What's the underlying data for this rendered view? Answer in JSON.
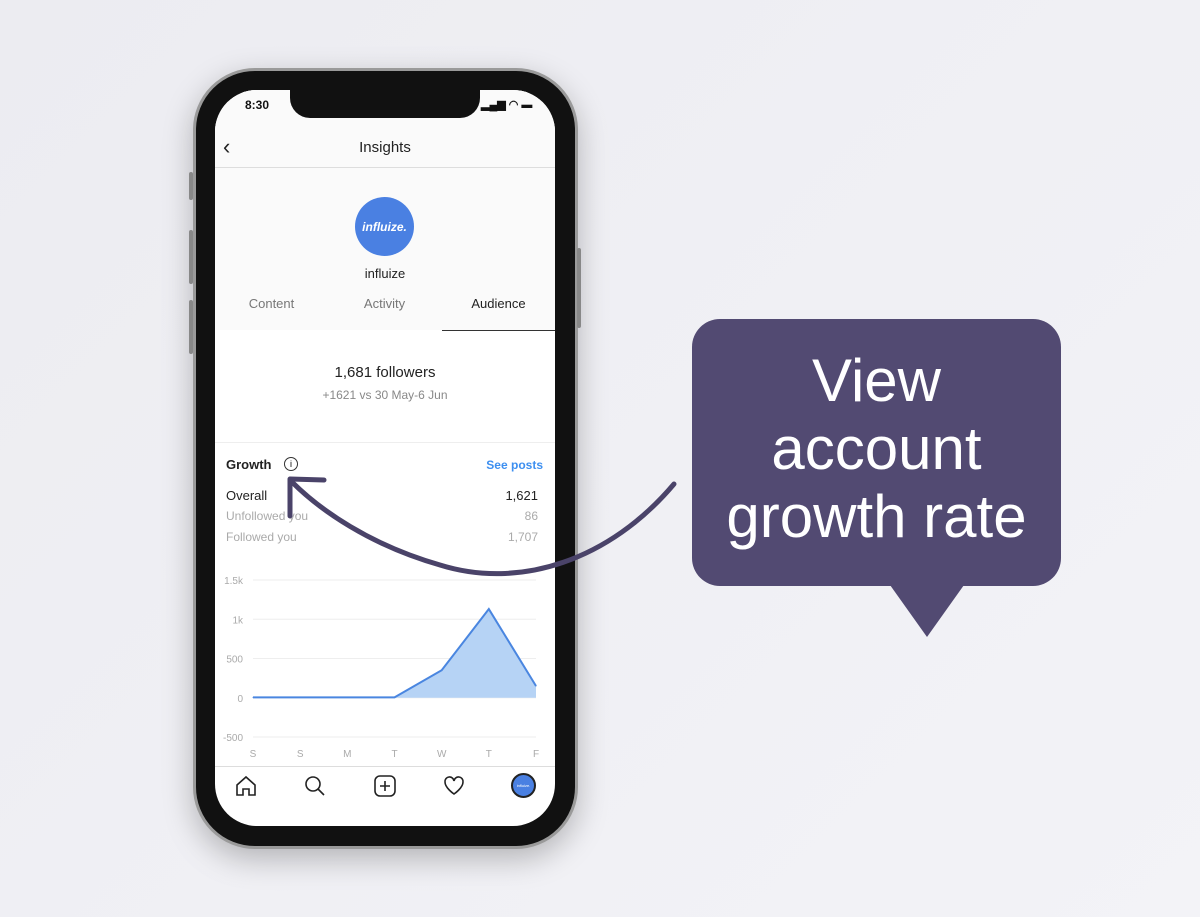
{
  "status": {
    "time": "8:30"
  },
  "header": {
    "title": "Insights"
  },
  "profile": {
    "logo_text": "influize.",
    "name": "influize"
  },
  "tabs": [
    {
      "label": "Content"
    },
    {
      "label": "Activity"
    },
    {
      "label": "Audience",
      "active": true
    }
  ],
  "followers": {
    "count": "1,681 followers",
    "delta": "+1621 vs 30 May-6 Jun"
  },
  "growth": {
    "title": "Growth",
    "see_posts": "See posts",
    "rows": [
      {
        "label": "Overall",
        "value": "1,621"
      },
      {
        "label": "Unfollowed you",
        "value": "86"
      },
      {
        "label": "Followed you",
        "value": "1,707"
      }
    ]
  },
  "chart_data": {
    "type": "area",
    "categories": [
      "S",
      "S",
      "M",
      "T",
      "W",
      "T",
      "F"
    ],
    "values": [
      5,
      5,
      5,
      5,
      350,
      1130,
      150
    ],
    "yticks": [
      "1.5k",
      "1k",
      "500",
      "0",
      "-500"
    ],
    "ylim": [
      -500,
      1500
    ],
    "grid": true,
    "color": "#4a86e0"
  },
  "nav": [
    "home-icon",
    "search-icon",
    "add-icon",
    "heart-icon",
    "profile-avatar"
  ],
  "callout": {
    "line1": "View",
    "line2": "account",
    "bold": "growth",
    "rest": " rate",
    "color": "#524a72"
  }
}
